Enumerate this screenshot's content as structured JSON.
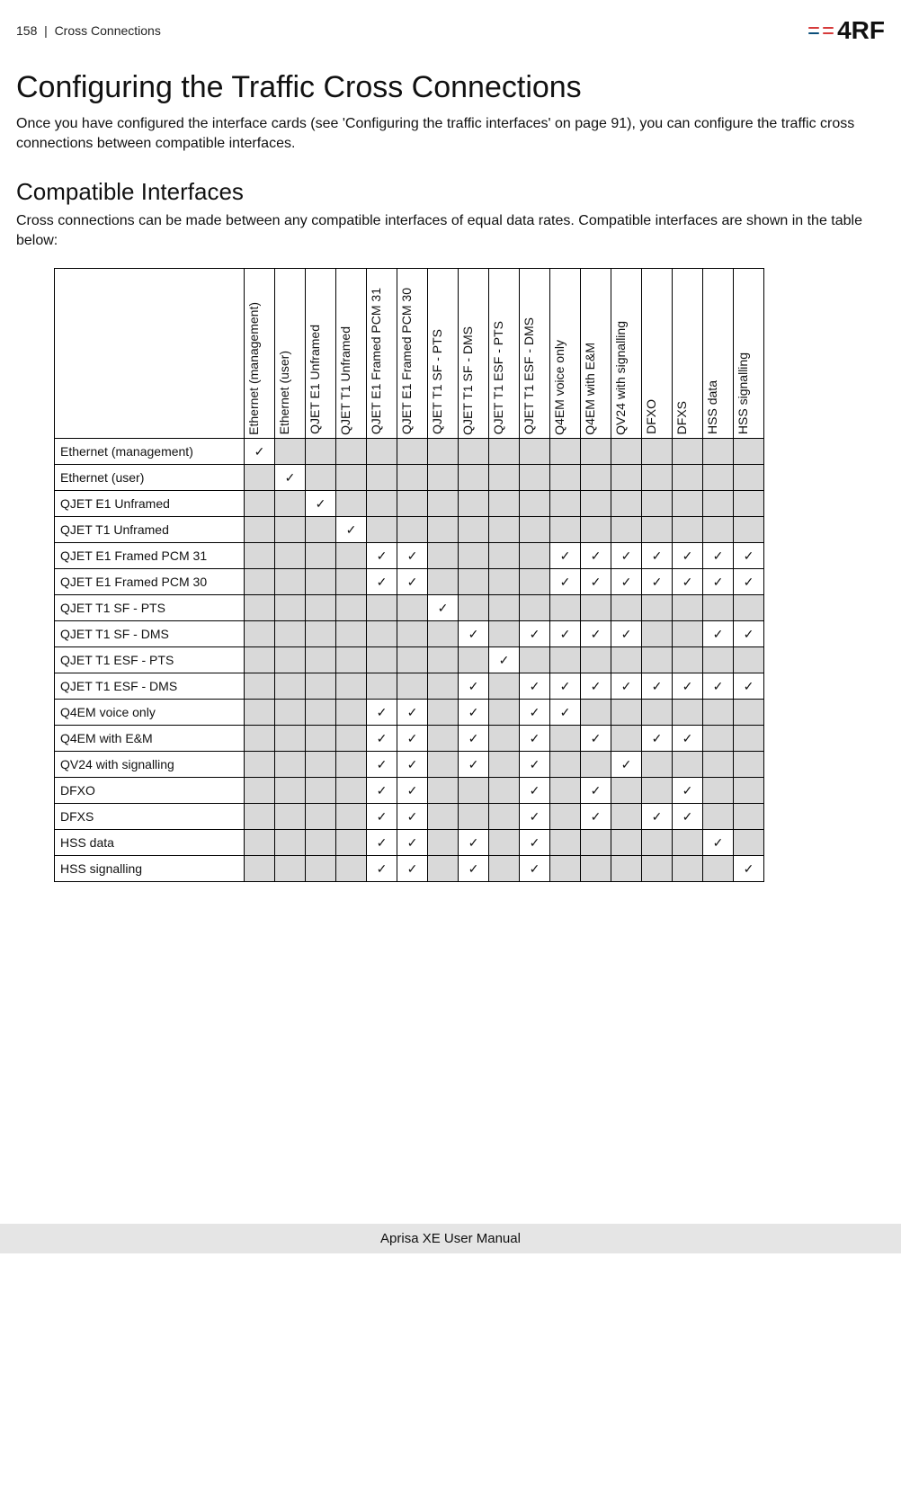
{
  "header": {
    "page_number": "158",
    "section": "Cross Connections",
    "logo_text": "4RF"
  },
  "title": "Configuring the Traffic Cross Connections",
  "intro": "Once you have configured the interface cards (see 'Configuring the traffic interfaces' on page 91), you can configure the traffic cross connections between compatible interfaces.",
  "subheading": "Compatible Interfaces",
  "sub_intro": "Cross connections can be made between any compatible interfaces of equal data rates. Compatible interfaces are shown in the table below:",
  "labels": [
    "Ethernet (management)",
    "Ethernet (user)",
    "QJET E1 Unframed",
    "QJET T1 Unframed",
    "QJET E1 Framed PCM 31",
    "QJET E1 Framed PCM 30",
    "QJET T1 SF - PTS",
    "QJET T1 SF - DMS",
    "QJET T1 ESF - PTS",
    "QJET T1 ESF - DMS",
    "Q4EM voice only",
    "Q4EM with E&M",
    "QV24 with signalling",
    "DFXO",
    "DFXS",
    "HSS data",
    "HSS signalling"
  ],
  "chart_data": {
    "type": "table",
    "title": "Compatible Interfaces Matrix",
    "row_headers": [
      "Ethernet (management)",
      "Ethernet (user)",
      "QJET E1 Unframed",
      "QJET T1 Unframed",
      "QJET E1 Framed PCM 31",
      "QJET E1 Framed PCM 30",
      "QJET T1 SF - PTS",
      "QJET T1 SF - DMS",
      "QJET T1 ESF - PTS",
      "QJET T1 ESF - DMS",
      "Q4EM voice only",
      "Q4EM with E&M",
      "QV24 with signalling",
      "DFXO",
      "DFXS",
      "HSS data",
      "HSS signalling"
    ],
    "col_headers": [
      "Ethernet (management)",
      "Ethernet (user)",
      "QJET E1 Unframed",
      "QJET T1 Unframed",
      "QJET E1 Framed PCM 31",
      "QJET E1 Framed PCM 30",
      "QJET T1 SF - PTS",
      "QJET T1 SF - DMS",
      "QJET T1 ESF - PTS",
      "QJET T1 ESF - DMS",
      "Q4EM voice only",
      "Q4EM with E&M",
      "QV24 with signalling",
      "DFXO",
      "DFXS",
      "HSS data",
      "HSS signalling"
    ],
    "matrix": [
      [
        1,
        0,
        0,
        0,
        0,
        0,
        0,
        0,
        0,
        0,
        0,
        0,
        0,
        0,
        0,
        0,
        0
      ],
      [
        0,
        1,
        0,
        0,
        0,
        0,
        0,
        0,
        0,
        0,
        0,
        0,
        0,
        0,
        0,
        0,
        0
      ],
      [
        0,
        0,
        1,
        0,
        0,
        0,
        0,
        0,
        0,
        0,
        0,
        0,
        0,
        0,
        0,
        0,
        0
      ],
      [
        0,
        0,
        0,
        1,
        0,
        0,
        0,
        0,
        0,
        0,
        0,
        0,
        0,
        0,
        0,
        0,
        0
      ],
      [
        0,
        0,
        0,
        0,
        1,
        1,
        0,
        0,
        0,
        0,
        1,
        1,
        1,
        1,
        1,
        1,
        1
      ],
      [
        0,
        0,
        0,
        0,
        1,
        1,
        0,
        0,
        0,
        0,
        1,
        1,
        1,
        1,
        1,
        1,
        1
      ],
      [
        0,
        0,
        0,
        0,
        0,
        0,
        1,
        0,
        0,
        0,
        0,
        0,
        0,
        0,
        0,
        0,
        0
      ],
      [
        0,
        0,
        0,
        0,
        0,
        0,
        0,
        1,
        0,
        1,
        1,
        1,
        1,
        0,
        0,
        1,
        1
      ],
      [
        0,
        0,
        0,
        0,
        0,
        0,
        0,
        0,
        1,
        0,
        0,
        0,
        0,
        0,
        0,
        0,
        0
      ],
      [
        0,
        0,
        0,
        0,
        0,
        0,
        0,
        1,
        0,
        1,
        1,
        1,
        1,
        1,
        1,
        1,
        1
      ],
      [
        0,
        0,
        0,
        0,
        1,
        1,
        0,
        1,
        0,
        1,
        1,
        0,
        0,
        0,
        0,
        0,
        0
      ],
      [
        0,
        0,
        0,
        0,
        1,
        1,
        0,
        1,
        0,
        1,
        0,
        1,
        0,
        1,
        1,
        0,
        0
      ],
      [
        0,
        0,
        0,
        0,
        1,
        1,
        0,
        1,
        0,
        1,
        0,
        0,
        1,
        0,
        0,
        0,
        0
      ],
      [
        0,
        0,
        0,
        0,
        1,
        1,
        0,
        0,
        0,
        1,
        0,
        1,
        0,
        0,
        1,
        0,
        0
      ],
      [
        0,
        0,
        0,
        0,
        1,
        1,
        0,
        0,
        0,
        1,
        0,
        1,
        0,
        1,
        1,
        0,
        0
      ],
      [
        0,
        0,
        0,
        0,
        1,
        1,
        0,
        1,
        0,
        1,
        0,
        0,
        0,
        0,
        0,
        1,
        0
      ],
      [
        0,
        0,
        0,
        0,
        1,
        1,
        0,
        1,
        0,
        1,
        0,
        0,
        0,
        0,
        0,
        0,
        1
      ]
    ]
  },
  "footer": "Aprisa XE User Manual"
}
